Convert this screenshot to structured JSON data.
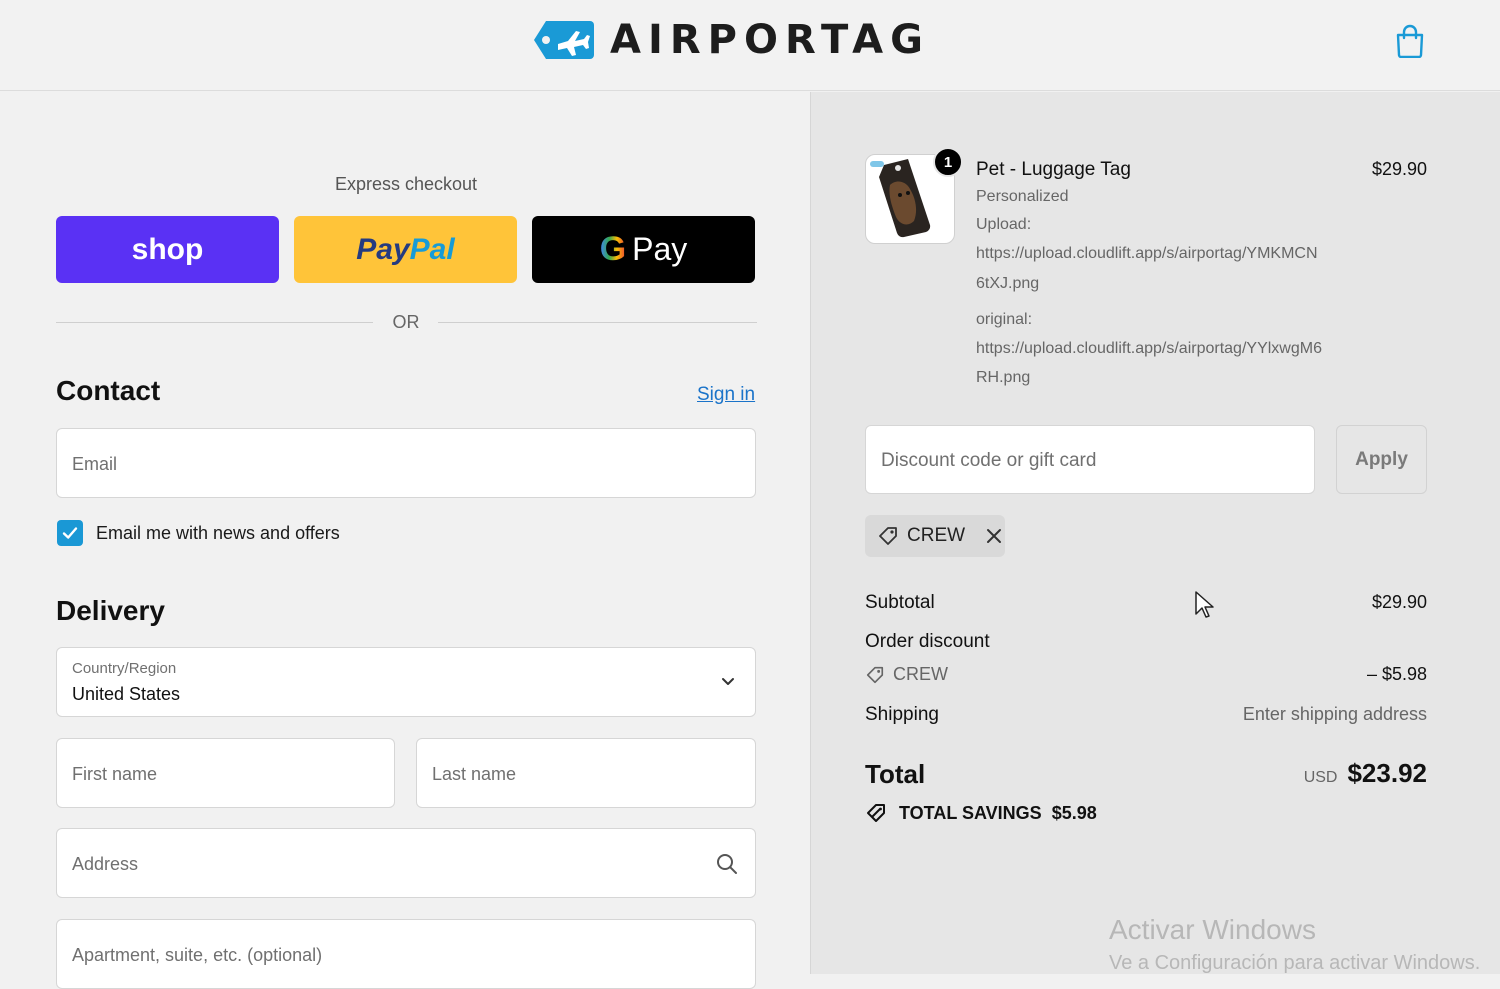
{
  "header": {
    "brand": "AIRPORTAG",
    "cart_icon": "shopping-bag-icon"
  },
  "express": {
    "title": "Express checkout",
    "shop_label": "shop",
    "paypal_label_1": "Pay",
    "paypal_label_2": "Pal",
    "gpay_g": "G",
    "gpay_label": "Pay",
    "or_text": "OR"
  },
  "contact": {
    "title": "Contact",
    "sign_in": "Sign in",
    "email_placeholder": "Email",
    "newsletter_label": "Email me with news and offers",
    "newsletter_checked": true
  },
  "delivery": {
    "title": "Delivery",
    "country_label": "Country/Region",
    "country_value": "United States",
    "first_name_placeholder": "First name",
    "last_name_placeholder": "Last name",
    "address_placeholder": "Address",
    "apartment_placeholder": "Apartment, suite, etc. (optional)"
  },
  "cart": {
    "item": {
      "quantity": "1",
      "name": "Pet - Luggage Tag",
      "price": "$29.90",
      "meta_1": "Personalized",
      "meta_2": "Upload:",
      "meta_3": "https://upload.cloudlift.app/s/airportag/YMKMCN",
      "meta_4": "6tXJ.png",
      "meta_5": "original:",
      "meta_6": "https://upload.cloudlift.app/s/airportag/YYlxwgM6",
      "meta_7": "RH.png"
    },
    "discount_placeholder": "Discount code or gift card",
    "apply_label": "Apply",
    "applied_code": "CREW",
    "subtotal_label": "Subtotal",
    "subtotal_value": "$29.90",
    "order_discount_label": "Order discount",
    "order_discount_code": "CREW",
    "order_discount_value": "– $5.98",
    "shipping_label": "Shipping",
    "shipping_value": "Enter shipping address",
    "total_label": "Total",
    "total_currency": "USD",
    "total_value": "$23.92",
    "savings_label": "TOTAL SAVINGS",
    "savings_value": "$5.98"
  },
  "watermark": {
    "line1": "Activar Windows",
    "line2": "Ve a Configuración para activar Windows."
  },
  "colors": {
    "shop": "#5a31f4",
    "paypal": "#ffc439",
    "accent": "#1a98d5",
    "brand": "#1a9ad6"
  }
}
